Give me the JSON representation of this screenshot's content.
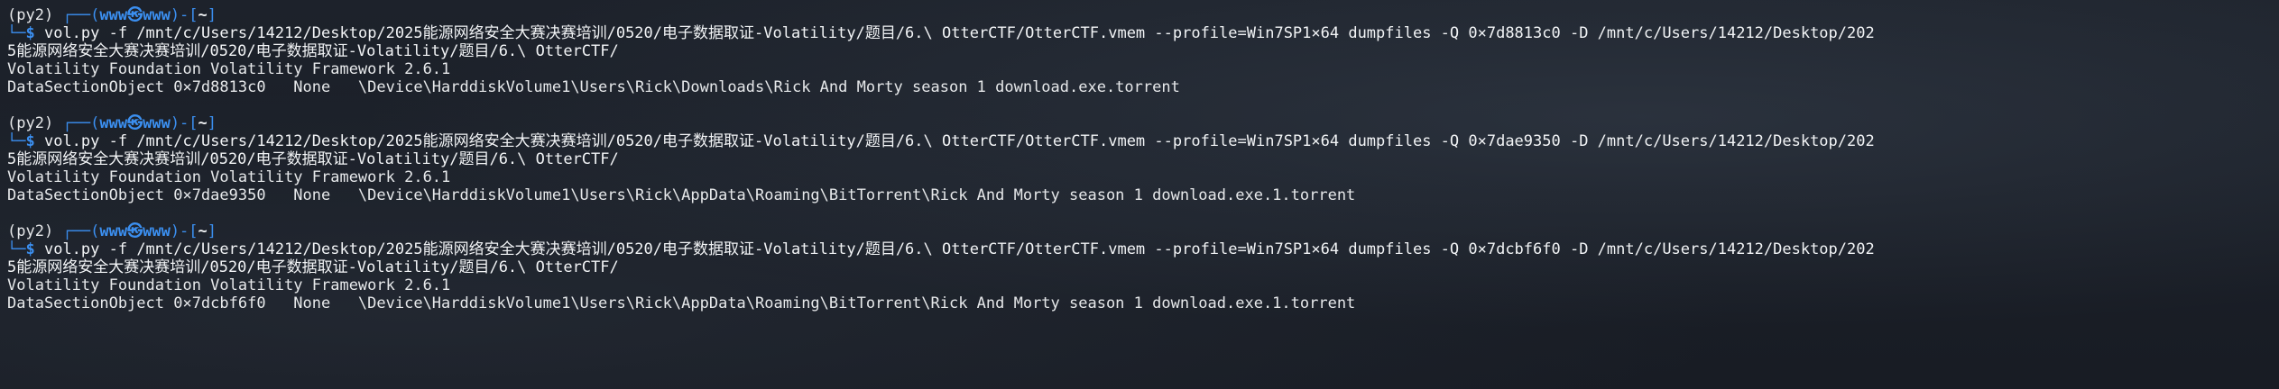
{
  "colors": {
    "background": "#1b2029",
    "prompt_frame": "#3b8ff0",
    "text": "#e6e8ea"
  },
  "prompt": {
    "env": "(py2)",
    "frame_open": " ┌──(",
    "user": "www",
    "separator_icon": "㉿",
    "host": "www",
    "frame_mid": ")-[",
    "cwd": "~",
    "frame_close": "]",
    "frame_bottom": "└─",
    "dollar": "$"
  },
  "blocks": [
    {
      "command_line1": " vol.py -f /mnt/c/Users/14212/Desktop/2025能源网络安全大赛决赛培训/0520/电子数据取证-Volatility/题目/6.\\ OtterCTF/OtterCTF.vmem --profile=Win7SP1×64 dumpfiles -Q 0×7d8813c0 -D /mnt/c/Users/14212/Desktop/202",
      "command_line2": "5能源网络安全大赛决赛培训/0520/电子数据取证-Volatility/题目/6.\\ OtterCTF/",
      "output1": "Volatility Foundation Volatility Framework 2.6.1",
      "output2": "DataSectionObject 0×7d8813c0   None   \\Device\\HarddiskVolume1\\Users\\Rick\\Downloads\\Rick And Morty season 1 download.exe.torrent"
    },
    {
      "command_line1": " vol.py -f /mnt/c/Users/14212/Desktop/2025能源网络安全大赛决赛培训/0520/电子数据取证-Volatility/题目/6.\\ OtterCTF/OtterCTF.vmem --profile=Win7SP1×64 dumpfiles -Q 0×7dae9350 -D /mnt/c/Users/14212/Desktop/202",
      "command_line2": "5能源网络安全大赛决赛培训/0520/电子数据取证-Volatility/题目/6.\\ OtterCTF/",
      "output1": "Volatility Foundation Volatility Framework 2.6.1",
      "output2": "DataSectionObject 0×7dae9350   None   \\Device\\HarddiskVolume1\\Users\\Rick\\AppData\\Roaming\\BitTorrent\\Rick And Morty season 1 download.exe.1.torrent"
    },
    {
      "command_line1": " vol.py -f /mnt/c/Users/14212/Desktop/2025能源网络安全大赛决赛培训/0520/电子数据取证-Volatility/题目/6.\\ OtterCTF/OtterCTF.vmem --profile=Win7SP1×64 dumpfiles -Q 0×7dcbf6f0 -D /mnt/c/Users/14212/Desktop/202",
      "command_line2": "5能源网络安全大赛决赛培训/0520/电子数据取证-Volatility/题目/6.\\ OtterCTF/",
      "output1": "Volatility Foundation Volatility Framework 2.6.1",
      "output2": "DataSectionObject 0×7dcbf6f0   None   \\Device\\HarddiskVolume1\\Users\\Rick\\AppData\\Roaming\\BitTorrent\\Rick And Morty season 1 download.exe.1.torrent"
    }
  ]
}
